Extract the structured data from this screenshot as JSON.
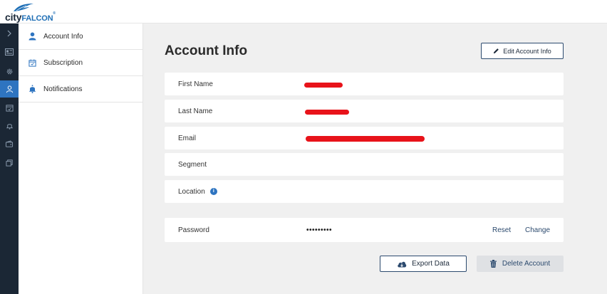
{
  "app": {
    "brand_part1": "city",
    "brand_part2": "FALCON",
    "brand_mark": "®"
  },
  "rail": {
    "icons": [
      "chevron-right-icon",
      "news-icon",
      "gear-icon",
      "user-icon",
      "calendar-icon",
      "bell-icon",
      "wallet-icon",
      "layers-icon"
    ],
    "active_index": 3,
    "active_color": "#2e74c0",
    "bg_color": "#1b2735"
  },
  "sidenav": {
    "items": [
      {
        "label": "Account Info",
        "icon": "user-icon",
        "active": true
      },
      {
        "label": "Subscription",
        "icon": "calendar-icon",
        "active": false
      },
      {
        "label": "Notifications",
        "icon": "bell-icon",
        "active": false
      }
    ]
  },
  "main": {
    "title": "Account Info",
    "edit_button": "Edit Account Info",
    "fields": [
      {
        "label": "First Name",
        "value": "",
        "redacted": true
      },
      {
        "label": "Last Name",
        "value": "",
        "redacted": true
      },
      {
        "label": "Email",
        "value": "",
        "redacted": true
      },
      {
        "label": "Segment",
        "value": ""
      },
      {
        "label": "Location",
        "value": "",
        "info_icon": true
      }
    ],
    "password": {
      "label": "Password",
      "value": "•••••••••",
      "reset_label": "Reset",
      "change_label": "Change"
    },
    "export_button": "Export Data",
    "delete_button": "Delete Account"
  },
  "colors": {
    "accent": "#2e74c0",
    "navy": "#2c4a6e",
    "redaction": "#e8131a",
    "panel_bg": "#f0f0f0"
  }
}
